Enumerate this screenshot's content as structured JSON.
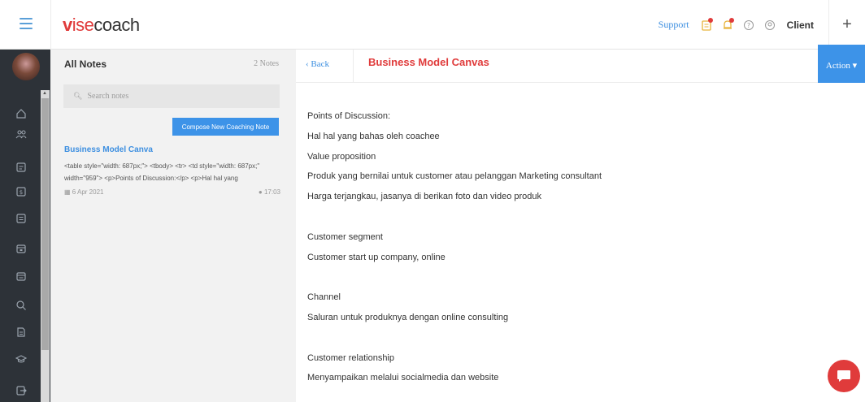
{
  "brand": {
    "logo": "visecoach",
    "accent": "#e03b3b",
    "link": "#3d8fe0"
  },
  "topbar": {
    "support_label": "Support",
    "client_label": "Client",
    "plus_label": "+"
  },
  "notes": {
    "title": "All Notes",
    "count": "2 Notes",
    "search_placeholder": "Search notes",
    "compose_label": "Compose New Coaching Note",
    "items": [
      {
        "title": "Business Model Canva",
        "snippet": "<table style=\"width: 687px;\"> <tbody> <tr> <td style=\"width: 687px;\" width=\"959\"> <p>Points of Discussion:</p> <p>Hal hal yang",
        "date": "6 Apr 2021",
        "time": "17:03"
      }
    ]
  },
  "main": {
    "back_label": "‹ Back",
    "title": "Business Model Canvas",
    "action_label": "Action ▾",
    "lines": [
      "Points of Discussion:",
      "Hal hal yang bahas oleh coachee",
      "Value proposition",
      "Produk yang bernilai untuk customer atau pelanggan  Marketing consultant",
      "Harga terjangkau, jasanya di berikan foto dan video produk",
      "",
      "Customer segment",
      "Customer start up company, online",
      "",
      "Channel",
      "Saluran untuk produknya dengan online consulting",
      "",
      "Customer relationship",
      "Menyampaikan melalui socialmedia dan website"
    ]
  },
  "sidebar_icons": [
    "home-icon",
    "users-icon",
    "document-icon",
    "dollar-icon",
    "chat-icon",
    "calendar-icon",
    "calendar-check-icon",
    "search-icon",
    "file-icon",
    "graduation-icon",
    "logout-icon"
  ]
}
